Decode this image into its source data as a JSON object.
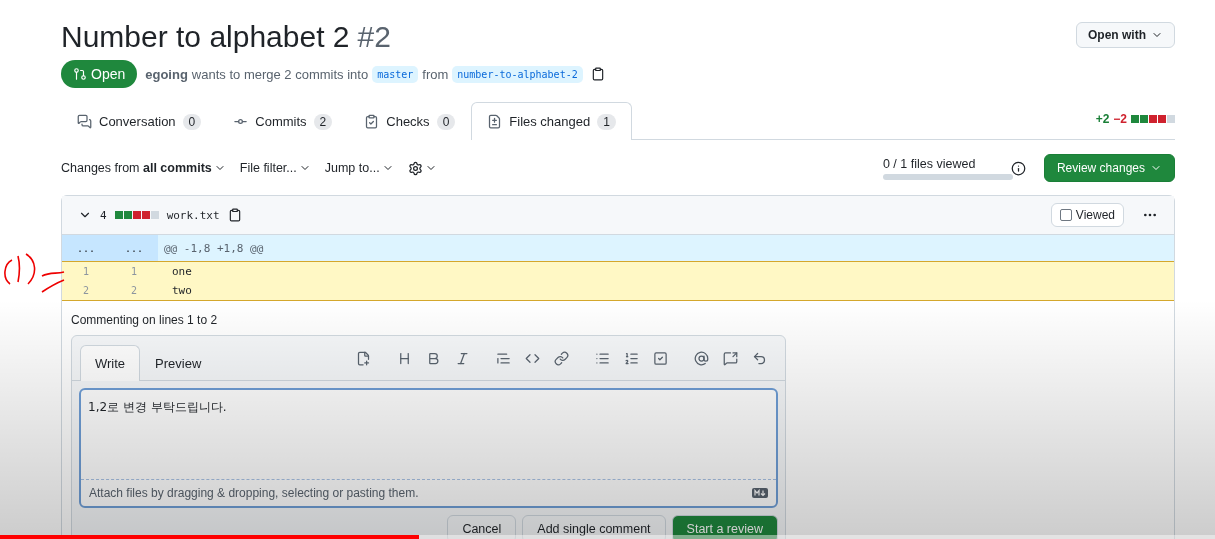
{
  "pull_request": {
    "title": "Number to alphabet 2",
    "number": "#2",
    "state": "Open",
    "author": "egoing",
    "summary": "wants to merge 2 commits into",
    "base_branch": "master",
    "from_word": "from",
    "head_branch": "number-to-alphabet-2"
  },
  "open_with": "Open with",
  "tabs": [
    {
      "label": "Conversation",
      "count": "0",
      "selected": false
    },
    {
      "label": "Commits",
      "count": "2",
      "selected": false
    },
    {
      "label": "Checks",
      "count": "0",
      "selected": false
    },
    {
      "label": "Files changed",
      "count": "1",
      "selected": true
    }
  ],
  "diffstat": {
    "added": "+2",
    "removed": "−2",
    "blocks": [
      {
        "color": "#1f883d"
      },
      {
        "color": "#1f883d"
      },
      {
        "color": "#cf222e"
      },
      {
        "color": "#cf222e"
      },
      {
        "color": "#d1d9e0"
      }
    ]
  },
  "toolbar": {
    "changes_from": "Changes from **all commits**",
    "file_filter": "File filter...",
    "jump_to": "Jump to...",
    "files_viewed": "0 / 1 files viewed",
    "viewed_bar": {
      "level": 0
    },
    "review_button": "Review changes"
  },
  "file": {
    "expanded": true,
    "changes": "4",
    "blocks": [
      {
        "color": "#1f883d"
      },
      {
        "color": "#1f883d"
      },
      {
        "color": "#cf222e"
      },
      {
        "color": "#cf222e"
      },
      {
        "color": "#d1d9e0"
      }
    ],
    "name": "work.txt",
    "viewed_label": "Viewed",
    "viewed": false,
    "hunk": {
      "old": "...",
      "new": "...",
      "header": "@@ -1,8 +1,8 @@"
    },
    "lines": [
      {
        "old": "1",
        "new": "1",
        "code": "one",
        "selected": true
      },
      {
        "old": "2",
        "new": "2",
        "code": "two",
        "selected": true
      }
    ]
  },
  "comment": {
    "caption": "Commenting on lines 1 to 2",
    "tabs": [
      {
        "label": "Write",
        "selected": true
      },
      {
        "label": "Preview",
        "selected": false
      }
    ],
    "value": "1,2로 변경 부탁드립니다.",
    "attach_hint": "Attach files by dragging & dropping, selecting or pasting them.",
    "buttons": [
      {
        "label": "Cancel",
        "kind": "default"
      },
      {
        "label": "Add single comment",
        "kind": "default"
      },
      {
        "label": "Start a review",
        "kind": "primary"
      }
    ]
  },
  "video_progress": {
    "level": 0.345
  }
}
